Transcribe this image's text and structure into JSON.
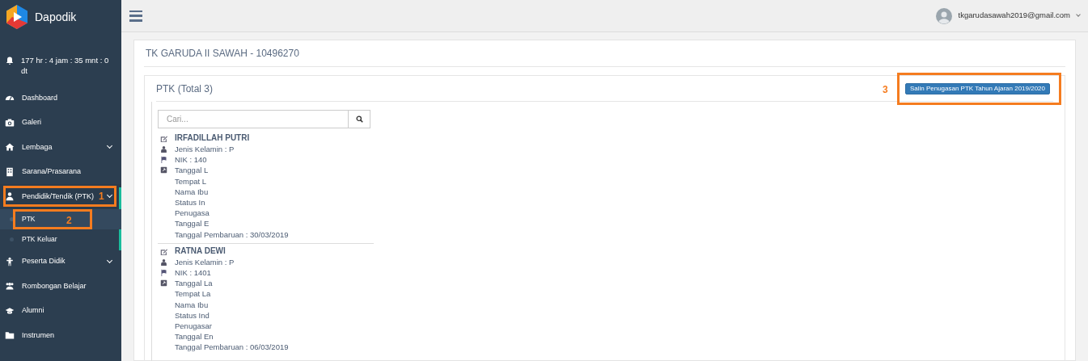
{
  "app": {
    "name": "Dapodik"
  },
  "notification": {
    "text": "177 hr : 4 jam : 35 mnt : 0 dt"
  },
  "sidebar": {
    "items": [
      {
        "label": "Dashboard",
        "has_submenu": false
      },
      {
        "label": "Galeri",
        "has_submenu": false
      },
      {
        "label": "Lembaga",
        "has_submenu": true,
        "expanded": false
      },
      {
        "label": "Sarana/Prasarana",
        "has_submenu": false
      },
      {
        "label": "Pendidik/Tendik (PTK)",
        "has_submenu": true,
        "expanded": true,
        "annotation": "1",
        "children": [
          {
            "label": "PTK",
            "selected": true,
            "annotation": "2"
          },
          {
            "label": "PTK Keluar",
            "selected": false
          }
        ]
      },
      {
        "label": "Peserta Didik",
        "has_submenu": true,
        "expanded": false
      },
      {
        "label": "Rombongan Belajar",
        "has_submenu": false
      },
      {
        "label": "Alumni",
        "has_submenu": false
      },
      {
        "label": "Instrumen",
        "has_submenu": false
      }
    ]
  },
  "user": {
    "email": "tkgarudasawah2019@gmail.com"
  },
  "school": {
    "title": "TK GARUDA II SAWAH - 10496270"
  },
  "panel": {
    "title": "PTK (Total 3)",
    "button": "Salin Penugasan PTK Tahun Ajaran 2019/2020",
    "annotation": "3"
  },
  "search": {
    "placeholder": "Cari..."
  },
  "ptk": [
    {
      "name": "IRFADILLAH PUTRI",
      "lines": [
        "Jenis Kelamin : P",
        "NIK : 140",
        "Tanggal L",
        "Tempat L",
        "Nama Ibu",
        "Status In",
        "Penugasa",
        "Tanggal E",
        "Tanggal Pembaruan : 30/03/2019"
      ]
    },
    {
      "name": "RATNA DEWI",
      "lines": [
        "Jenis Kelamin : P",
        "NIK : 1401",
        "Tanggal La",
        "Tempat La",
        "Nama Ibu",
        "Status Ind",
        "Penugasar",
        "Tanggal En",
        "Tanggal Pembaruan : 06/03/2019"
      ]
    }
  ]
}
